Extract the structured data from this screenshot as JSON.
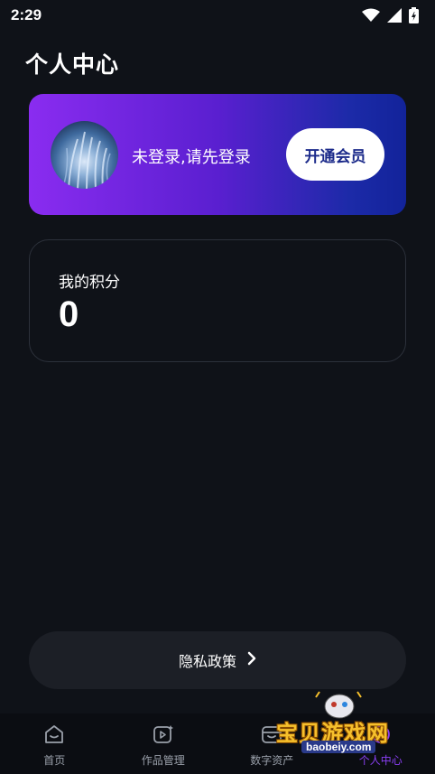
{
  "status_bar": {
    "time": "2:29",
    "icons": [
      "wifi-icon",
      "signal-icon",
      "battery-icon"
    ]
  },
  "header": {
    "title": "个人中心"
  },
  "profile_card": {
    "login_prompt": "未登录,请先登录",
    "vip_button_label": "开通会员",
    "gradient_colors": [
      "#8a2cf0",
      "#12239a"
    ]
  },
  "points": {
    "label": "我的积分",
    "value": "0"
  },
  "privacy": {
    "label": "隐私政策"
  },
  "tabs": [
    {
      "label": "首页",
      "icon": "home-icon",
      "active": false
    },
    {
      "label": "作品管理",
      "icon": "works-icon",
      "active": false
    },
    {
      "label": "数字资产",
      "icon": "assets-icon",
      "active": false
    },
    {
      "label": "个人中心",
      "icon": "profile-icon",
      "active": true
    }
  ],
  "colors": {
    "background": "#0f1218",
    "accent": "#8b3ff5"
  },
  "watermark": {
    "text": "宝贝游戏网",
    "url": "baobeiy.com"
  }
}
